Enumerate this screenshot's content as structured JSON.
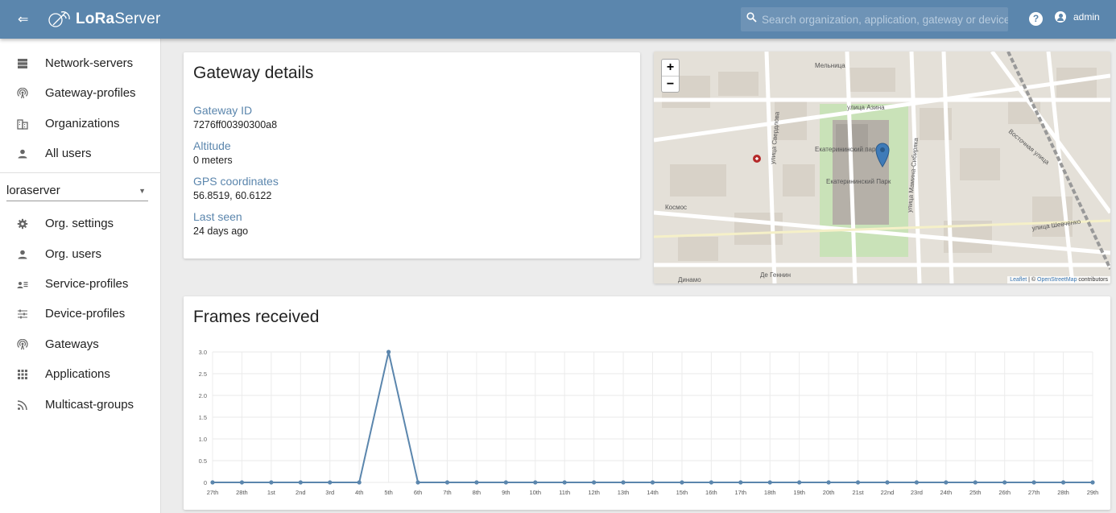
{
  "header": {
    "menu_icon": "menu-collapse-icon",
    "brand_bold": "LoRa",
    "brand_light": "Server",
    "search_placeholder": "Search organization, application, gateway or device",
    "user_name": "admin"
  },
  "sidebar": {
    "global_items": [
      {
        "label": "Network-servers",
        "icon": "server-icon"
      },
      {
        "label": "Gateway-profiles",
        "icon": "radio-tower-icon"
      },
      {
        "label": "Organizations",
        "icon": "domain-icon"
      },
      {
        "label": "All users",
        "icon": "account-icon"
      }
    ],
    "org_select": {
      "value": "loraserver"
    },
    "org_items": [
      {
        "label": "Org. settings",
        "icon": "settings-icon"
      },
      {
        "label": "Org. users",
        "icon": "account-icon"
      },
      {
        "label": "Service-profiles",
        "icon": "account-details-icon"
      },
      {
        "label": "Device-profiles",
        "icon": "tune-icon"
      },
      {
        "label": "Gateways",
        "icon": "radio-tower-icon"
      },
      {
        "label": "Applications",
        "icon": "apps-icon"
      },
      {
        "label": "Multicast-groups",
        "icon": "rss-icon"
      }
    ]
  },
  "details": {
    "title": "Gateway details",
    "fields": [
      {
        "label": "Gateway ID",
        "value": "7276ff00390300a8"
      },
      {
        "label": "Altitude",
        "value": "0 meters"
      },
      {
        "label": "GPS coordinates",
        "value": "56.8519, 60.6122"
      },
      {
        "label": "Last seen",
        "value": "24 days ago"
      }
    ]
  },
  "map": {
    "zoom_in": "+",
    "zoom_out": "−",
    "attribution_leaflet": "Leaflet",
    "attribution_sep": " | © ",
    "attribution_osm": "OpenStreetMap",
    "attribution_rest": " contributors",
    "labels": [
      "Мельница",
      "Екатерининский парк",
      "Екатерининский Парк",
      "улица Азина",
      "Восточная улица",
      "улица Шевченко",
      "Космос",
      "Де Геннин",
      "Динамо",
      "улица Свердлова",
      "улица Мамина-Сибиряка"
    ]
  },
  "frames": {
    "title": "Frames received"
  },
  "chart_data": {
    "type": "line",
    "categories": [
      "27th",
      "28th",
      "1st",
      "2nd",
      "3rd",
      "4th",
      "5th",
      "6th",
      "7th",
      "8th",
      "9th",
      "10th",
      "11th",
      "12th",
      "13th",
      "14th",
      "15th",
      "16th",
      "17th",
      "18th",
      "19th",
      "20th",
      "21st",
      "22nd",
      "23rd",
      "24th",
      "25th",
      "26th",
      "27th",
      "28th",
      "29th"
    ],
    "series": [
      {
        "values": [
          0,
          0,
          0,
          0,
          0,
          0,
          3,
          0,
          0,
          0,
          0,
          0,
          0,
          0,
          0,
          0,
          0,
          0,
          0,
          0,
          0,
          0,
          0,
          0,
          0,
          0,
          0,
          0,
          0,
          0,
          0
        ]
      }
    ],
    "ylim": [
      0,
      3
    ],
    "yticks": [
      "0",
      "0.5",
      "1.0",
      "1.5",
      "2.0",
      "2.5",
      "3.0"
    ],
    "grid": true,
    "color": "#5b86ad"
  }
}
